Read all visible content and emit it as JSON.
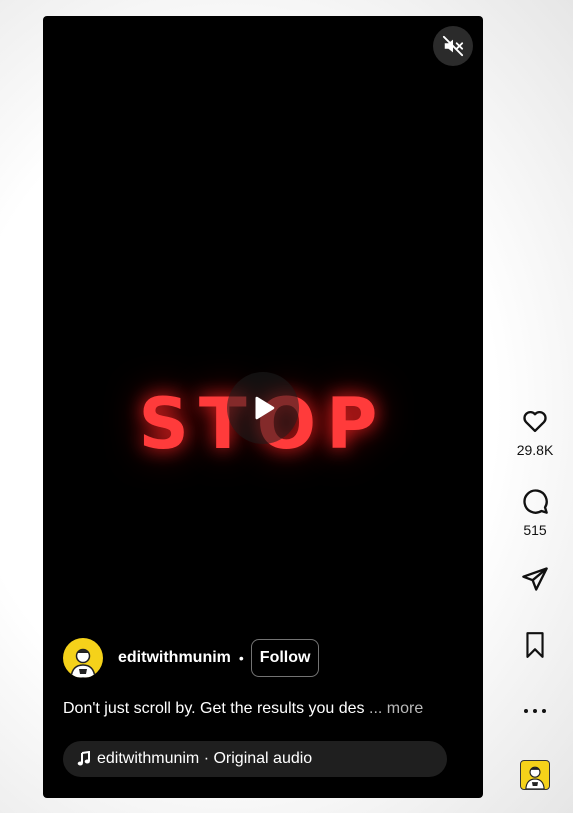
{
  "reel": {
    "overlay_word": "STOP",
    "mute_icon": "speaker-muted-icon",
    "play_icon": "play-icon"
  },
  "author": {
    "username": "editwithmunim",
    "separator": "•",
    "follow_label": "Follow"
  },
  "caption": {
    "text": "Don't just scroll by. Get the results you des",
    "ellipsis": " ...",
    "more_label": " more"
  },
  "audio": {
    "icon": "music-note-icon",
    "label": "editwithmunim · Original audio"
  },
  "actions": {
    "like_count": "29.8K",
    "comment_count": "515"
  },
  "colors": {
    "accent_red": "#ff3b3b",
    "avatar_yellow": "#f5d21a"
  }
}
